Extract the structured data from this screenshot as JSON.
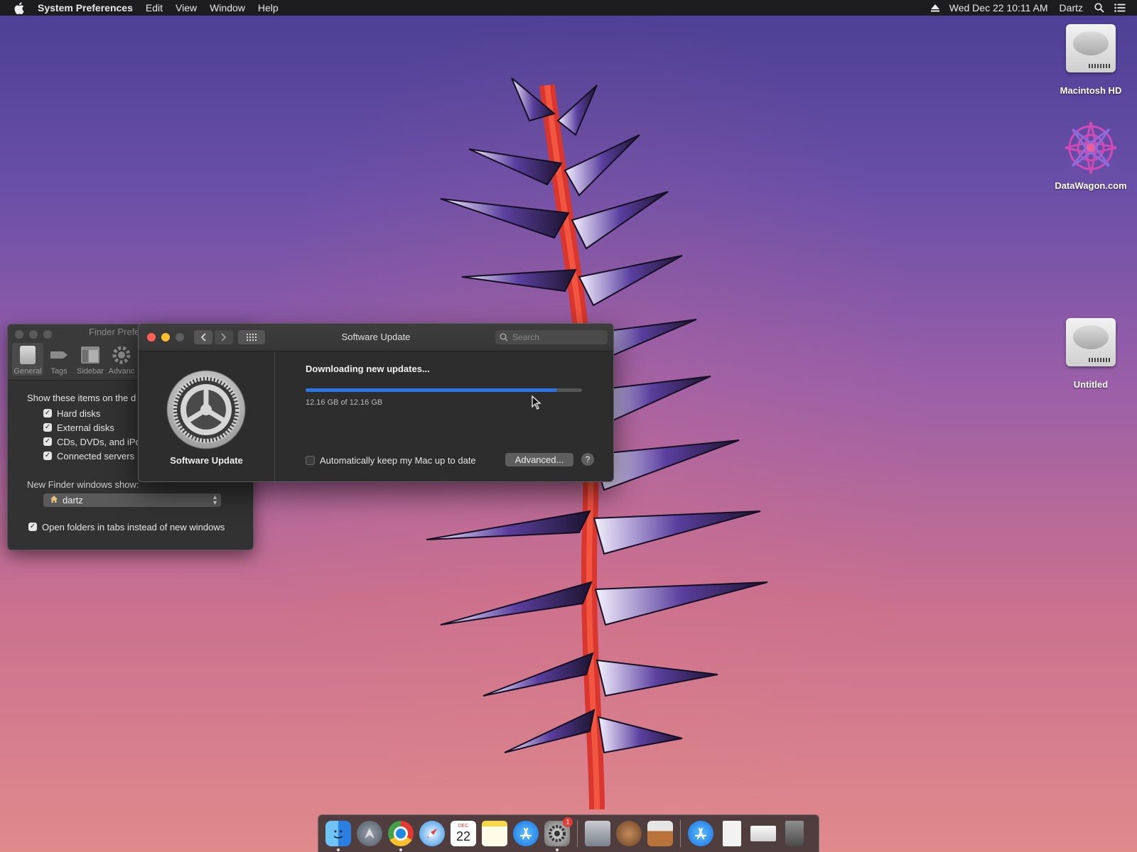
{
  "menubar": {
    "app_name": "System Preferences",
    "menus": [
      "Edit",
      "View",
      "Window",
      "Help"
    ],
    "datetime": "Wed Dec 22  10:11 AM",
    "user": "Dartz",
    "icons": [
      "apple-icon",
      "eject-icon",
      "spotlight-search-icon",
      "notification-center-icon"
    ]
  },
  "desktop": {
    "icons": [
      {
        "label": "Macintosh HD",
        "icon": "hard-drive-icon"
      },
      {
        "label": "DataWagon.com",
        "icon": "mandala-image-icon"
      },
      {
        "label": "Untitled",
        "icon": "hard-drive-icon"
      }
    ]
  },
  "finder_prefs": {
    "title": "Finder Prefe",
    "tabs": [
      {
        "label": "General",
        "icon": "general-switch-icon",
        "selected": true
      },
      {
        "label": "Tags",
        "icon": "tag-icon",
        "selected": false
      },
      {
        "label": "Sidebar",
        "icon": "sidebar-icon",
        "selected": false
      },
      {
        "label": "Advanc",
        "icon": "gear-icon",
        "selected": false
      }
    ],
    "show_items_label": "Show these items on the d",
    "items": [
      {
        "label": "Hard disks",
        "checked": true
      },
      {
        "label": "External disks",
        "checked": true
      },
      {
        "label": "CDs, DVDs, and iPo",
        "checked": true
      },
      {
        "label": "Connected servers",
        "checked": true
      }
    ],
    "new_windows_label": "New Finder windows show:",
    "new_windows_value": "dartz",
    "open_in_tabs": {
      "label": "Open folders in tabs instead of new windows",
      "checked": true
    }
  },
  "software_update": {
    "window_title": "Software Update",
    "search_placeholder": "Search",
    "pane_label": "Software Update",
    "status": "Downloading new updates...",
    "progress_fraction": 0.91,
    "size_text": "12.16 GB of 12.16 GB",
    "auto_update": {
      "label": "Automatically keep my Mac up to date",
      "checked": false
    },
    "advanced_label": "Advanced...",
    "help_label": "?",
    "colors": {
      "close": "#ff5f57",
      "minimize": "#febc2e",
      "zoom": "#5e5e5e",
      "progress": "#2c74e6"
    }
  },
  "dock": {
    "apps": [
      {
        "name": "finder-icon",
        "running": true,
        "badge": ""
      },
      {
        "name": "launchpad-icon",
        "running": false,
        "badge": ""
      },
      {
        "name": "chrome-icon",
        "running": true,
        "badge": ""
      },
      {
        "name": "safari-icon",
        "running": false,
        "badge": ""
      },
      {
        "name": "calendar-icon",
        "running": false,
        "badge": "",
        "month": "DEC",
        "day": "22"
      },
      {
        "name": "notes-icon",
        "running": false,
        "badge": ""
      },
      {
        "name": "app-store-icon",
        "running": false,
        "badge": ""
      },
      {
        "name": "system-preferences-icon",
        "running": true,
        "badge": "1"
      },
      {
        "name": "migration-assistant-icon",
        "running": false,
        "badge": ""
      },
      {
        "name": "utility-app-icon",
        "running": false,
        "badge": ""
      },
      {
        "name": "installer-icon",
        "running": false,
        "badge": ""
      },
      {
        "name": "app-store-folder-icon",
        "running": false,
        "badge": ""
      },
      {
        "name": "document-icon",
        "running": false,
        "badge": ""
      },
      {
        "name": "downloads-stack-icon",
        "running": false,
        "badge": ""
      },
      {
        "name": "trash-icon",
        "running": false,
        "badge": ""
      }
    ]
  }
}
